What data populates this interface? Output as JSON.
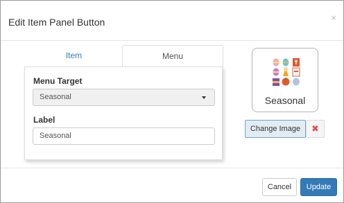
{
  "dialog": {
    "title": "Edit Item Panel Button",
    "close_glyph": "×"
  },
  "tabs": [
    {
      "label": "Item",
      "active": false
    },
    {
      "label": "Menu",
      "active": true
    }
  ],
  "menu_panel": {
    "menu_target_label": "Menu Target",
    "menu_target_value": "Seasonal",
    "label_label": "Label",
    "label_value": "Seasonal"
  },
  "image_panel": {
    "tile_label": "Seasonal",
    "tile_icon": "seasonal-items-icon-grid",
    "change_image_label": "Change Image",
    "remove_glyph": "✖"
  },
  "footer": {
    "cancel_label": "Cancel",
    "update_label": "Update"
  },
  "colors": {
    "primary": "#337ab7",
    "danger": "#d9534f",
    "tab_active_text": "#555555",
    "tab_inactive_text": "#337ab7"
  }
}
